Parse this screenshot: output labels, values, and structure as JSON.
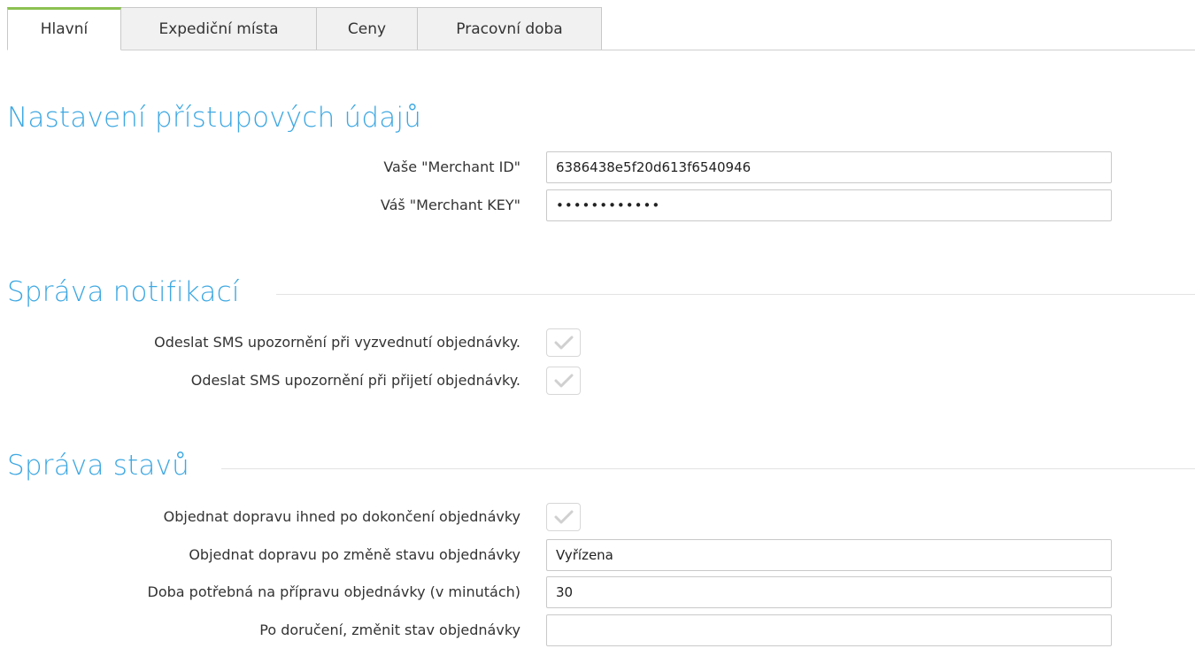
{
  "tabs": [
    {
      "label": "Hlavní",
      "active": true
    },
    {
      "label": "Expediční místa",
      "active": false
    },
    {
      "label": "Ceny",
      "active": false
    },
    {
      "label": "Pracovní doba",
      "active": false
    }
  ],
  "credentials": {
    "title": "Nastavení přístupových údajů",
    "merchant_id_label": "Vaše \"Merchant ID\"",
    "merchant_id_value": "6386438e5f20d613f6540946",
    "merchant_key_label": "Váš \"Merchant KEY\"",
    "merchant_key_value": "••••••••••••"
  },
  "notifications": {
    "title": "Správa notifikací",
    "sms_pickup_label": "Odeslat SMS upozornění při vyzvednutí objednávky.",
    "sms_pickup_checked": false,
    "sms_received_label": "Odeslat SMS upozornění při přijetí objednávky.",
    "sms_received_checked": false
  },
  "states": {
    "title": "Správa stavů",
    "order_on_complete_label": "Objednat dopravu ihned po dokončení objednávky",
    "order_on_complete_checked": false,
    "order_on_state_label": "Objednat dopravu po změně stavu objednávky",
    "order_on_state_value": "Vyřízena",
    "prep_time_label": "Doba potřebná na přípravu objednávky (v minutách)",
    "prep_time_value": "30",
    "after_delivery_label": "Po doručení, změnit stav objednávky",
    "after_delivery_value": ""
  },
  "colors": {
    "accent_blue": "#3ea8e2",
    "active_tab_green": "#8cc152",
    "check_icon_gray": "#d0d0d0"
  },
  "icons": {
    "checkbox_mark": "checkmark-icon"
  }
}
